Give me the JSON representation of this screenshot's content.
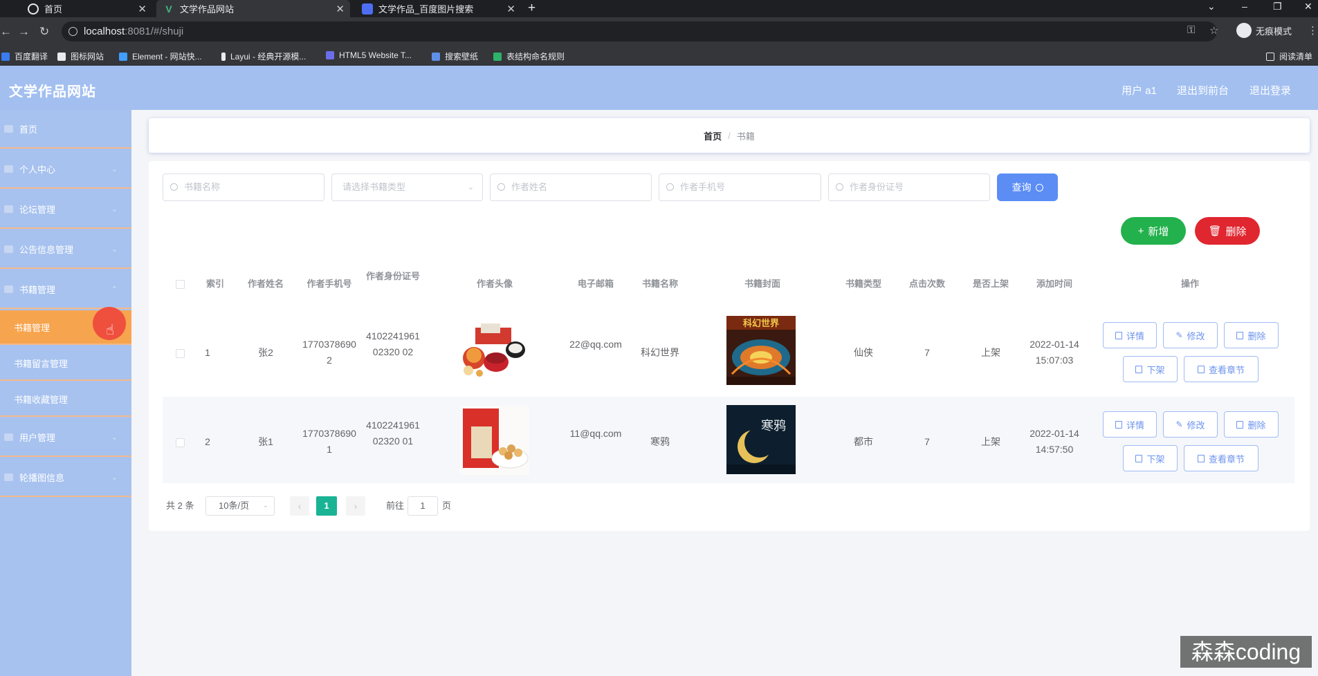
{
  "browser": {
    "tabs": [
      {
        "title": "首页"
      },
      {
        "title": "文学作品网站"
      },
      {
        "title": "文学作品_百度图片搜索"
      }
    ],
    "url_host": "localhost",
    "url_path": ":8081/#/shuji",
    "incognito_label": "无痕模式",
    "bookmarks": [
      "百度翻译",
      "图标网站",
      "Element - 网站快...",
      "Layui - 经典开源模...",
      "HTML5 Website T...",
      "搜索壁纸",
      "表结构命名规则"
    ],
    "reading_list": "阅读清单"
  },
  "header": {
    "brand": "文学作品网站",
    "user": "用户 a1",
    "back_to_front": "退出到前台",
    "logout": "退出登录"
  },
  "sidebar": {
    "items": [
      {
        "label": "首页"
      },
      {
        "label": "个人中心"
      },
      {
        "label": "论坛管理"
      },
      {
        "label": "公告信息管理"
      },
      {
        "label": "书籍管理"
      },
      {
        "label": "用户管理"
      },
      {
        "label": "轮播图信息"
      }
    ],
    "sub_items": [
      {
        "label": "书籍管理"
      },
      {
        "label": "书籍留言管理"
      },
      {
        "label": "书籍收藏管理"
      }
    ]
  },
  "breadcrumb": {
    "home": "首页",
    "sep": "/",
    "current": "书籍"
  },
  "search": {
    "book_name": "书籍名称",
    "book_type": "请选择书籍类型",
    "author_name": "作者姓名",
    "author_phone": "作者手机号",
    "author_id": "作者身份证号",
    "query_label": "查询"
  },
  "actions": {
    "add": "新增",
    "delete": "删除"
  },
  "table": {
    "headers": [
      "索引",
      "作者姓名",
      "作者手机号",
      "作者身份证号",
      "作者头像",
      "电子邮箱",
      "书籍名称",
      "书籍封面",
      "书籍类型",
      "点击次数",
      "是否上架",
      "添加时间",
      "操作"
    ],
    "rows": [
      {
        "index": "1",
        "author": "张2",
        "phone": "17703786902",
        "idcard": "410224196102320 02",
        "email": "22@qq.com",
        "book": "科幻世界",
        "cover_text": "科幻世界",
        "type": "仙侠",
        "clicks": "7",
        "shelf": "上架",
        "time": "2022-01-14 15:07:03"
      },
      {
        "index": "2",
        "author": "张1",
        "phone": "17703786901",
        "idcard": "410224196102320 01",
        "email": "11@qq.com",
        "book": "寒鸦",
        "cover_text": "寒鸦",
        "type": "都市",
        "clicks": "7",
        "shelf": "上架",
        "time": "2022-01-14 14:57:50"
      }
    ],
    "op_labels": {
      "detail": "详情",
      "edit": "修改",
      "delete": "删除",
      "unshelf": "下架",
      "chapters": "查看章节"
    }
  },
  "pagination": {
    "total": "共 2 条",
    "page_size": "10条/页",
    "current": "1",
    "goto_prefix": "前往",
    "goto_value": "1",
    "goto_suffix": "页"
  },
  "watermark": "森森coding",
  "colors": {
    "header": "#a2bff0",
    "sidebar": "#a7c2ef",
    "active": "#f7a44e",
    "primary": "#5b8df5",
    "success": "#22b14c",
    "danger": "#e0262f"
  }
}
